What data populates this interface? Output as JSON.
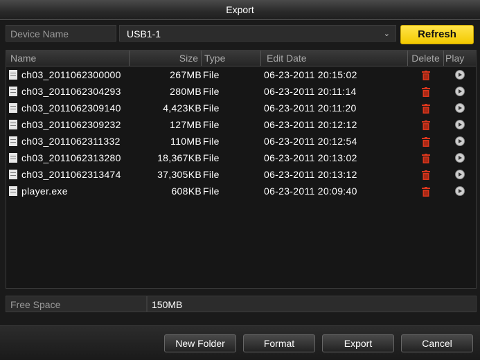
{
  "window": {
    "title": "Export"
  },
  "device": {
    "label": "Device Name",
    "selected": "USB1-1",
    "refresh_label": "Refresh"
  },
  "table": {
    "columns": {
      "name": "Name",
      "size": "Size",
      "type": "Type",
      "date": "Edit Date",
      "delete": "Delete",
      "play": "Play"
    },
    "rows": [
      {
        "name": "ch03_2011062300000",
        "size": "267MB",
        "type": "File",
        "date": "06-23-2011 20:15:02"
      },
      {
        "name": "ch03_2011062304293",
        "size": "280MB",
        "type": "File",
        "date": "06-23-2011 20:11:14"
      },
      {
        "name": "ch03_2011062309140",
        "size": "4,423KB",
        "type": "File",
        "date": "06-23-2011 20:11:20"
      },
      {
        "name": "ch03_2011062309232",
        "size": "127MB",
        "type": "File",
        "date": "06-23-2011 20:12:12"
      },
      {
        "name": "ch03_2011062311332",
        "size": "110MB",
        "type": "File",
        "date": "06-23-2011 20:12:54"
      },
      {
        "name": "ch03_2011062313280",
        "size": "18,367KB",
        "type": "File",
        "date": "06-23-2011 20:13:02"
      },
      {
        "name": "ch03_2011062313474",
        "size": "37,305KB",
        "type": "File",
        "date": "06-23-2011 20:13:12"
      },
      {
        "name": "player.exe",
        "size": "608KB",
        "type": "File",
        "date": "06-23-2011 20:09:40"
      }
    ]
  },
  "free_space": {
    "label": "Free Space",
    "value": "150MB"
  },
  "buttons": {
    "new_folder": "New Folder",
    "format": "Format",
    "export": "Export",
    "cancel": "Cancel"
  },
  "colors": {
    "accent": "#f3c900",
    "delete_icon": "#d9361c"
  }
}
